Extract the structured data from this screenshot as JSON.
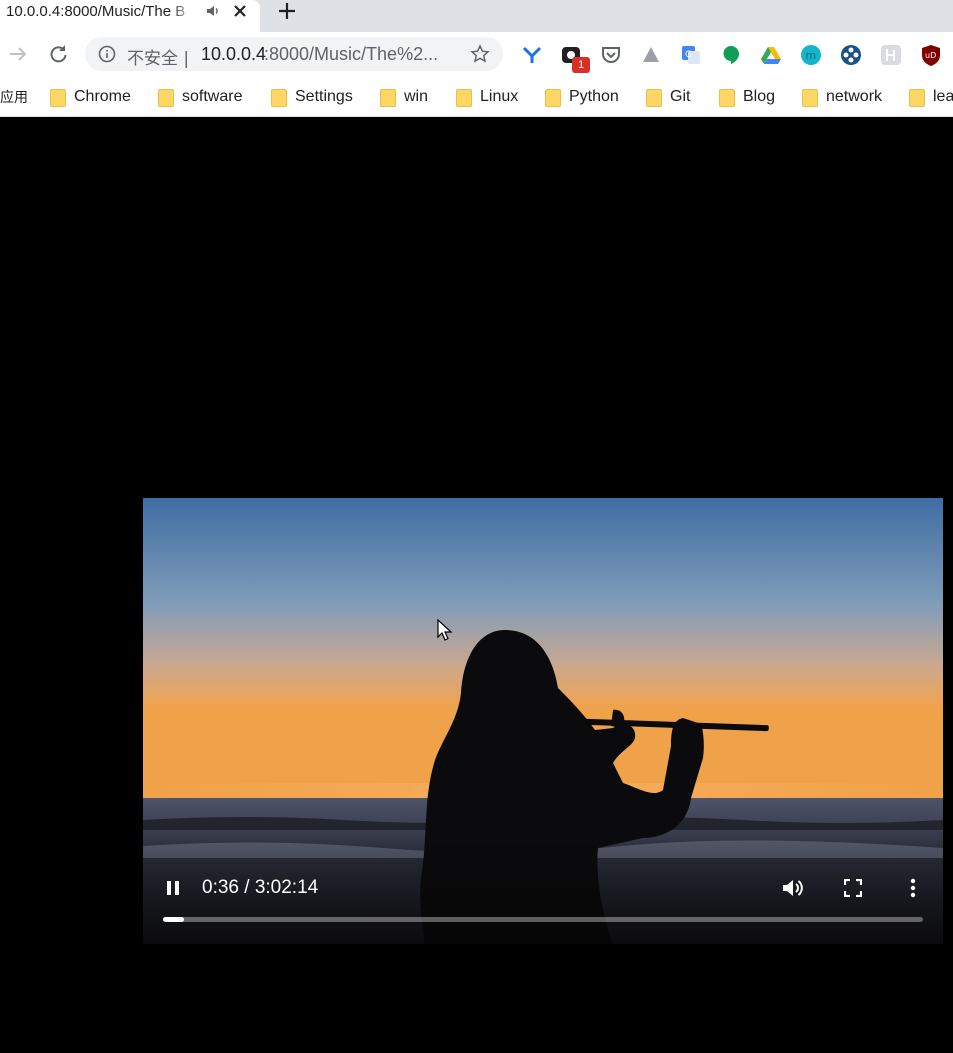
{
  "tab": {
    "title": "10.0.0.4:8000/Music/The B",
    "audio_icon": "speaker-icon",
    "close_icon": "close-icon",
    "new_tab_icon": "plus-icon"
  },
  "toolbar": {
    "back_icon": "arrow-left-icon",
    "forward_icon": "arrow-right-icon",
    "reload_icon": "reload-icon",
    "security_text": "不安全 |",
    "url_host": "10.0.0.4",
    "url_rest": ":8000/Music/The%2...",
    "bookmark_star_icon": "star-icon",
    "extensions": [
      {
        "name": "y-ext-icon",
        "color": "#1a73e8"
      },
      {
        "name": "camera-ext-icon",
        "color": "#202124",
        "badge": "1"
      },
      {
        "name": "pocket-icon",
        "color": "#5f6368"
      },
      {
        "name": "triangle-ext-icon",
        "color": "#9aa0a6"
      },
      {
        "name": "google-translate-icon",
        "color": "#4285f4"
      },
      {
        "name": "hangouts-icon",
        "color": "#0f9d58"
      },
      {
        "name": "google-drive-icon",
        "color": "#34a853"
      },
      {
        "name": "m-ext-icon",
        "color": "#12b5cb"
      },
      {
        "name": "network-ext-icon",
        "color": "#1a73e8"
      },
      {
        "name": "character-ext-icon",
        "color": "#9aa0a6"
      },
      {
        "name": "ublock-icon",
        "color": "#800000"
      }
    ]
  },
  "bookmarks": {
    "apps_label": "应用",
    "items": [
      "Chrome",
      "software",
      "Settings",
      "win",
      "Linux",
      "Python",
      "Git",
      "Blog",
      "network",
      "lea"
    ]
  },
  "player": {
    "time": "0:36 / 3:02:14",
    "progress": 0.0033,
    "buffered_marker": 0.028,
    "play_state": "playing",
    "pause_icon": "pause-icon",
    "volume_icon": "volume-icon",
    "fullscreen_icon": "fullscreen-icon",
    "more_icon": "more-vertical-icon"
  }
}
